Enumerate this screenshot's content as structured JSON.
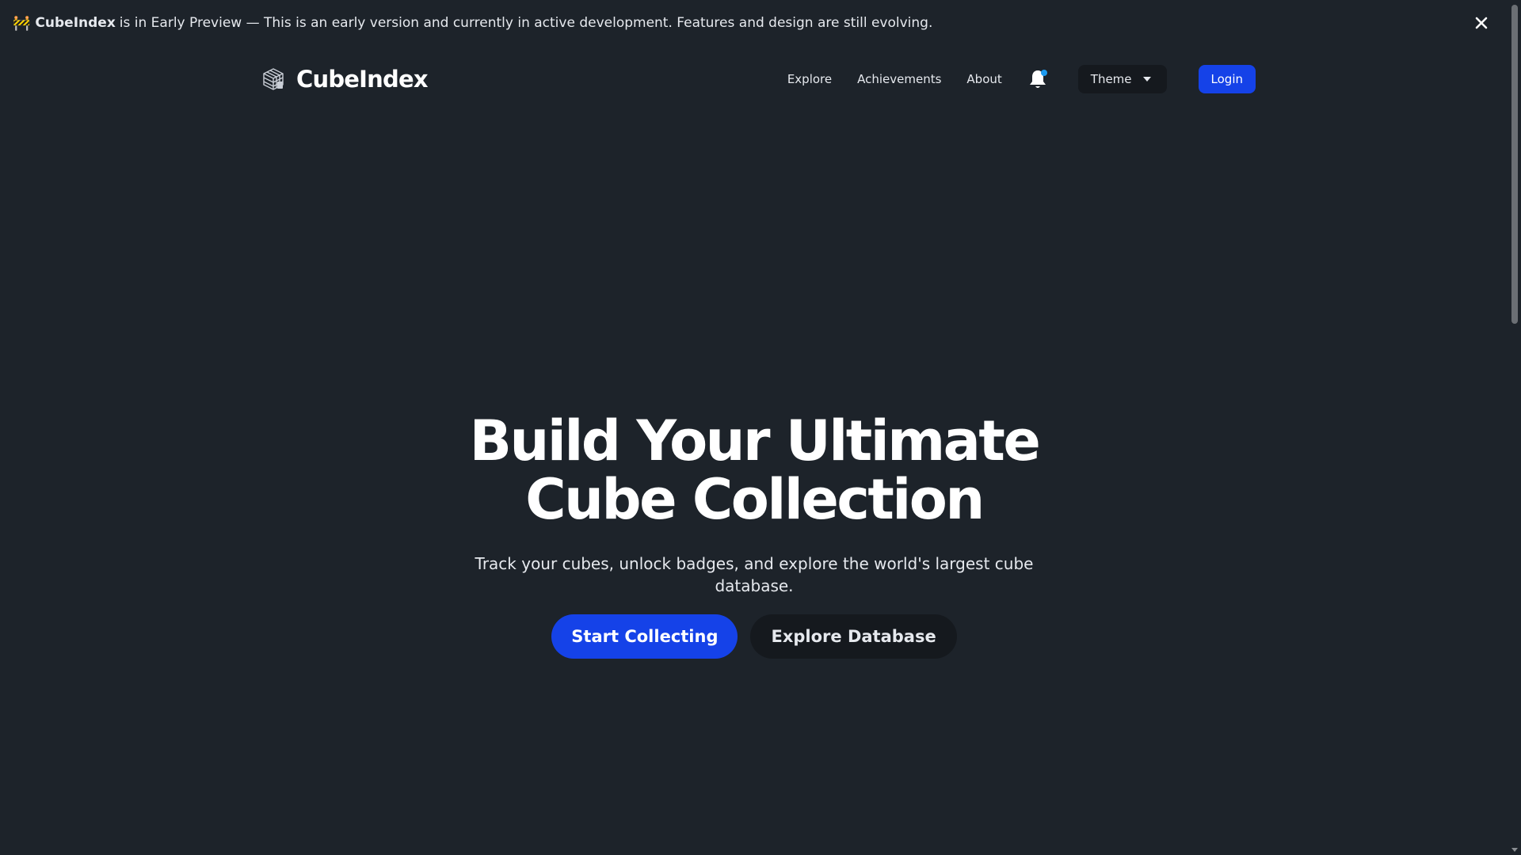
{
  "banner": {
    "emoji": "🚧",
    "brand": "CubeIndex",
    "message": "is in Early Preview — This is an early version and currently in active development. Features and design are still evolving.",
    "close_icon": "close-icon"
  },
  "navbar": {
    "logo_text": "CubeIndex",
    "logo_icon": "cube-logo-icon",
    "links": [
      "Explore",
      "Achievements",
      "About"
    ],
    "notification_icon": "bell-icon",
    "theme_label": "Theme",
    "login_label": "Login"
  },
  "hero": {
    "title_line1": "Build Your Ultimate",
    "title_line2": "Cube Collection",
    "subtitle": "Track your cubes, unlock badges, and explore the world's largest cube database.",
    "primary_cta": "Start Collecting",
    "secondary_cta": "Explore Database"
  },
  "colors": {
    "background": "#1d232a",
    "primary": "#1542e8",
    "surface_dark": "#15191e",
    "notification_dot": "#1d9bf0"
  }
}
